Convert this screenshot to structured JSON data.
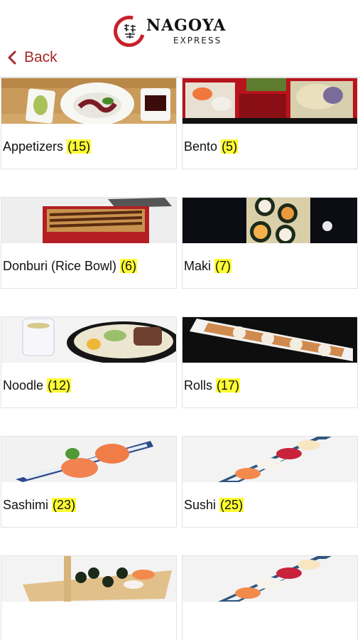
{
  "header": {
    "logo_name": "NAGOYA",
    "logo_sub": "EXPRESS",
    "back_label": "Back"
  },
  "categories": [
    {
      "name": "Appetizers",
      "count": "(15)"
    },
    {
      "name": "Bento",
      "count": "(5)"
    },
    {
      "name": "Donburi (Rice Bowl)",
      "count": "(6)"
    },
    {
      "name": "Maki",
      "count": "(7)"
    },
    {
      "name": "Noodle",
      "count": "(12)"
    },
    {
      "name": "Rolls",
      "count": "(17)"
    },
    {
      "name": "Sashimi",
      "count": "(23)"
    },
    {
      "name": "Sushi",
      "count": "(25)"
    }
  ],
  "colors": {
    "accent": "#a52a2a",
    "logo_red": "#c8202a",
    "highlight": "#ffff33"
  }
}
